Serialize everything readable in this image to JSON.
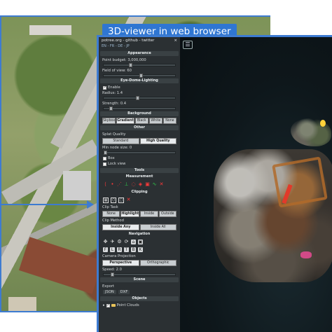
{
  "overlay_title": "3D-viewer in web browser",
  "viewer": {
    "menu_icon": "hamburger-menu-icon",
    "sidebar": {
      "header_line1": "potree.org - github - twitter",
      "header_close": "×",
      "languages": "EN - FR - DE - JP",
      "sections": {
        "appearance": "Appearance",
        "edl": "Eye-Dome-Lighting",
        "background": "Background",
        "other": "Other",
        "tools": "Tools",
        "measurement": "Measurement",
        "clipping": "Clipping",
        "navigation": "Navigation",
        "scene": "Scene",
        "objects": "Objects"
      },
      "point_budget": "Point budget: 3,000,000",
      "point_budget_level": 0.35,
      "field_of_view": "Field of view: 60",
      "field_of_view_level": 0.5,
      "edl_enable": "Enable",
      "edl_enabled": true,
      "radius": "Radius: 1.4",
      "radius_level": 0.45,
      "strength": "Strength: 0.4",
      "strength_level": 0.08,
      "background_options": [
        "Skybox",
        "Gradient",
        "Black",
        "White",
        "None"
      ],
      "background_selected": "Gradient",
      "splat_quality_label": "Splat Quality",
      "splat_quality_options": [
        "Standard",
        "High Quality"
      ],
      "splat_quality_selected": "High Quality",
      "min_node_size": "Min node size: 0",
      "min_node_size_level": 0.0,
      "box_label": "Box",
      "lock_view_label": "Lock view",
      "clip_task_label": "Clip Task",
      "clip_task_options": [
        "None",
        "Highlight",
        "Inside",
        "Outside"
      ],
      "clip_task_selected": "Highlight",
      "clip_method_label": "Clip Method",
      "clip_method_options": [
        "Inside Any",
        "Inside All"
      ],
      "camera_projection_label": "Camera Projection",
      "camera_projection_options": [
        "Perspective",
        "Orthographic"
      ],
      "speed": "Speed: 2.0",
      "speed_level": 0.1,
      "export_label": "Export",
      "export_options": [
        "JSON",
        "DXF"
      ],
      "point_clouds_label": "Point Clouds"
    }
  },
  "colors": {
    "accent": "#2f76d2",
    "sidebar_bg": "#2b3033",
    "canvas_bg": "#0e171b"
  }
}
